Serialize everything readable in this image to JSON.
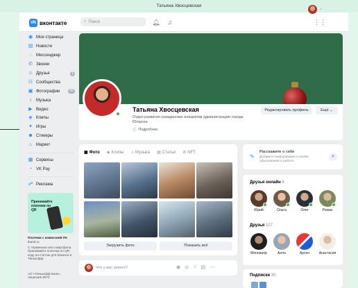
{
  "window": {
    "title": "Татьяна Хвосцевская"
  },
  "header": {
    "logo_text": "вконтакте",
    "logo_badge": "VK",
    "search_placeholder": "Поиск",
    "icons": [
      "bell-icon",
      "music-icon",
      "apps-icon"
    ]
  },
  "sidebar": {
    "items": [
      {
        "label": "Моя страница",
        "icon": "user-icon"
      },
      {
        "label": "Новости",
        "icon": "news-icon"
      },
      {
        "label": "Мессенджер",
        "icon": "message-icon"
      },
      {
        "label": "Звонки",
        "icon": "phone-icon"
      },
      {
        "label": "Друзья",
        "icon": "friends-icon",
        "badge": "1"
      },
      {
        "label": "Сообщества",
        "icon": "groups-icon"
      },
      {
        "label": "Фотографии",
        "icon": "photo-icon",
        "badge": "47"
      },
      {
        "label": "Музыка",
        "icon": "music-icon"
      },
      {
        "label": "Видео",
        "icon": "video-icon"
      },
      {
        "label": "Клипы",
        "icon": "clips-icon"
      },
      {
        "label": "Игры",
        "icon": "games-icon"
      },
      {
        "label": "Стикеры",
        "icon": "sticker-icon"
      },
      {
        "label": "Маркет",
        "icon": "market-icon"
      }
    ],
    "items2": [
      {
        "label": "Сервисы",
        "icon": "services-icon"
      },
      {
        "label": "VK Pay",
        "icon": "vkpay-icon"
      }
    ],
    "items3": [
      {
        "label": "Реклама",
        "icon": "ads-icon"
      }
    ]
  },
  "ad": {
    "card_title": "Принимайте платежи по QR",
    "headline": "Платежи с комиссией 0%",
    "domain": "tbank.ru",
    "body": "С терминала или смартфона. Принимайте платежи по QR-коду на счетом для бизнеса в Тинькофф",
    "legal": "АО «Тинькофф Банк», лицензия 2673"
  },
  "profile": {
    "name": "Татьяна Хвосцевская",
    "status": "Отдел развития гражданских инициатив администрации города Югорска",
    "more": "Подробнее",
    "edit_button": "Редактировать профиль",
    "more_button": "Ещё"
  },
  "media": {
    "tabs": [
      "Фото",
      "Клипы",
      "Музыка",
      "Статьи",
      "NFT"
    ],
    "upload_button": "Загрузить фото",
    "show_all_button": "Показать всё"
  },
  "composer": {
    "placeholder": "Что у вас нового?"
  },
  "right": {
    "tell_title": "Расскажите о себе",
    "tell_sub": "Добавьте информацию о своём образовании и работе",
    "online_title": "Друзья онлайн",
    "online_count": "8",
    "online_friends": [
      "Юрий",
      "Ольга",
      "Олег",
      "Роман"
    ],
    "friends_title": "Друзья",
    "friends_count": "107",
    "friends": [
      "Меннинор",
      "Алла",
      "Арсен",
      "Анастасия"
    ],
    "subs_title": "Подписки",
    "subs_count": "30"
  },
  "colors": {
    "accent": "#2787f5",
    "cover": "#2e6b47",
    "online": "#4bb34b"
  }
}
